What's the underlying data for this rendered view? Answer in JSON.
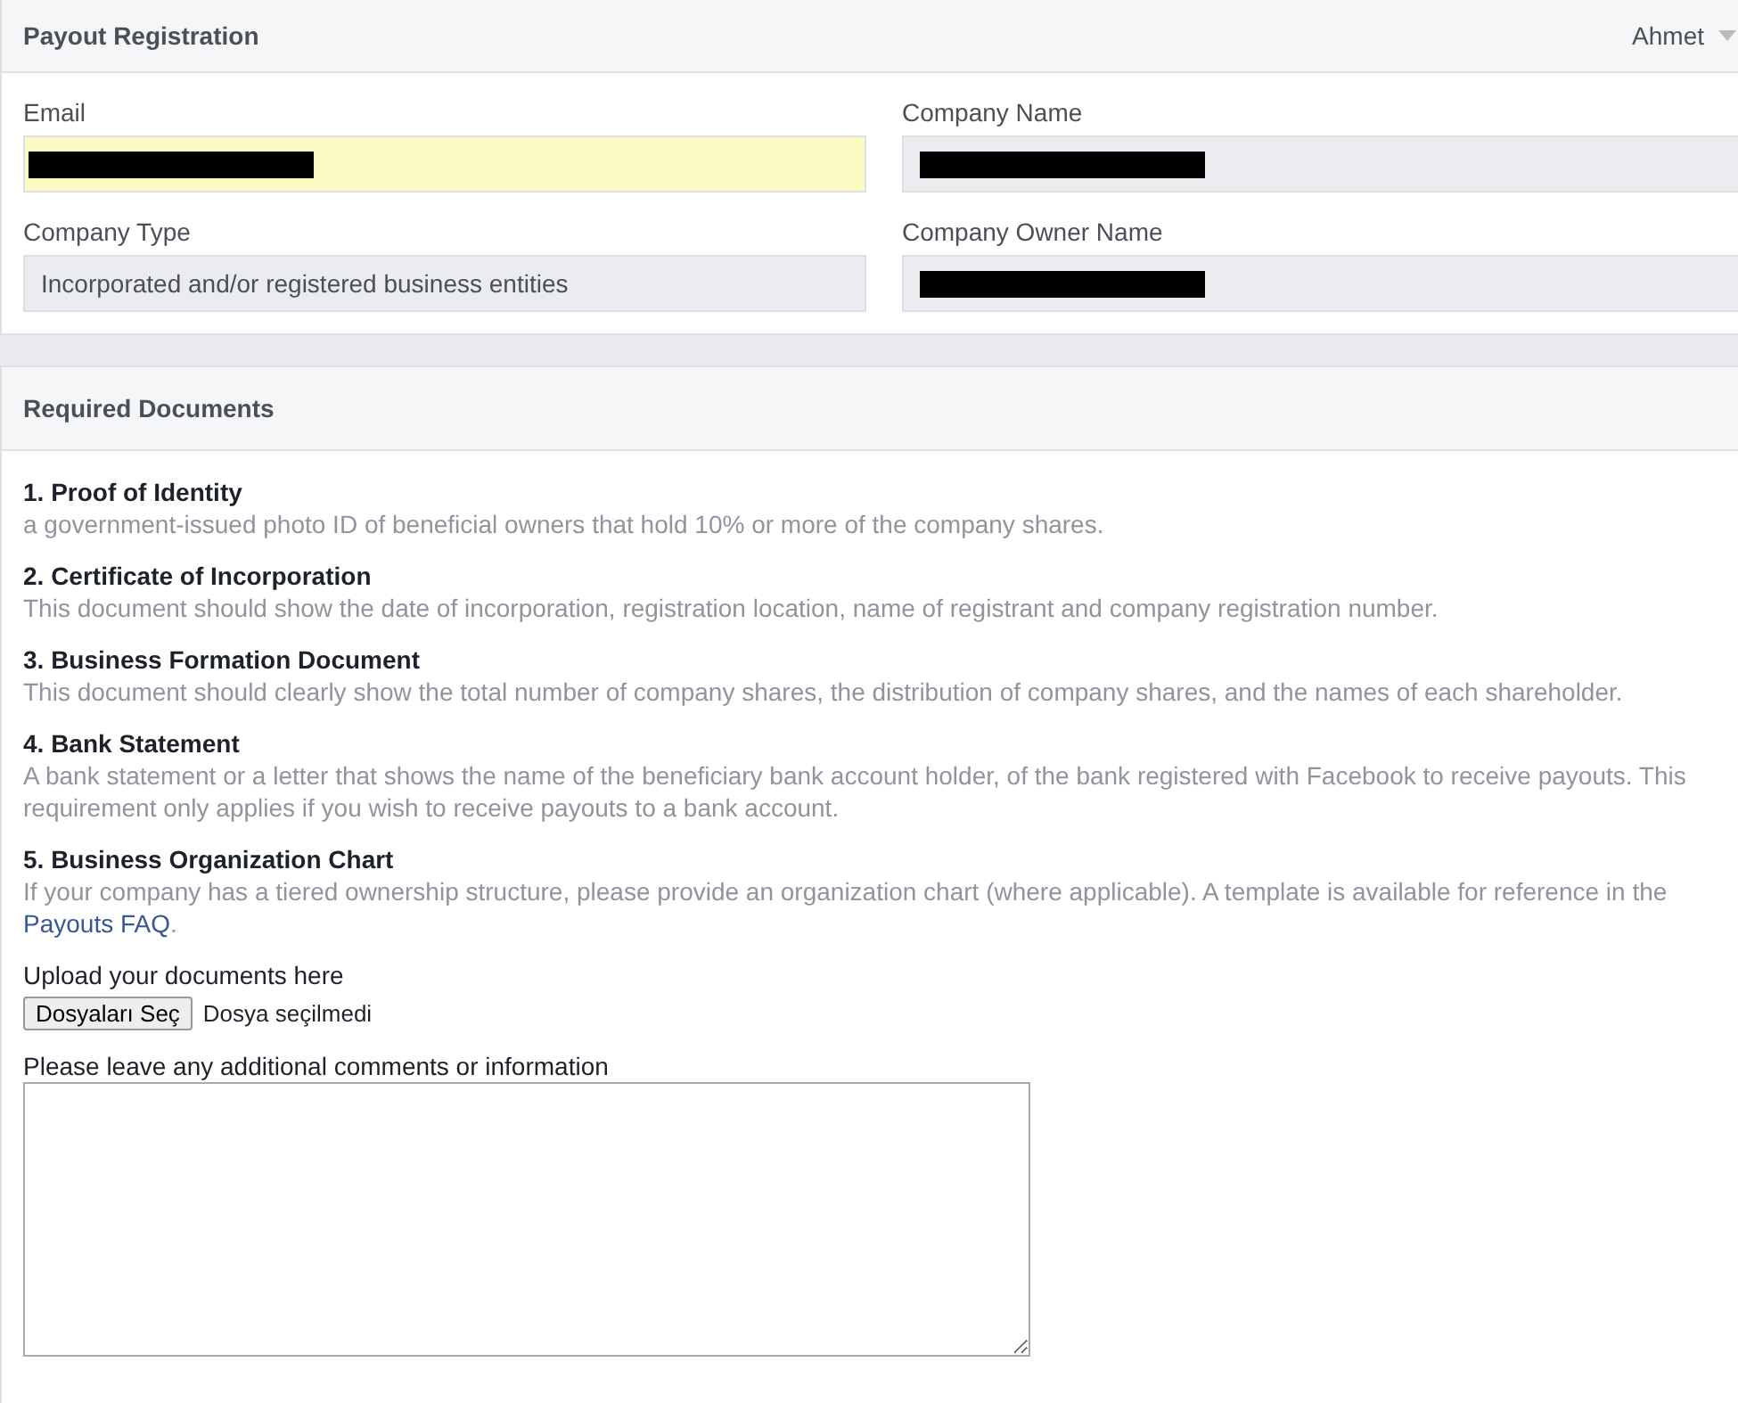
{
  "header": {
    "title": "Payout Registration",
    "user": "Ahmet"
  },
  "fields": [
    {
      "label": "Email",
      "redacted": true,
      "autofilled": true
    },
    {
      "label": "Company Name",
      "redacted": true,
      "autofilled": false
    },
    {
      "label": "Company Type",
      "redacted": false,
      "autofilled": false,
      "value": "Incorporated and/or registered business entities"
    },
    {
      "label": "Company Owner Name",
      "redacted": true,
      "autofilled": false
    }
  ],
  "documents": {
    "title": "Required Documents",
    "items": [
      {
        "title": "1. Proof of Identity",
        "description": "a government-issued photo ID of beneficial owners that hold 10% or more of the company shares."
      },
      {
        "title": "2. Certificate of Incorporation",
        "description": "This document should show the date of incorporation, registration location, name of registrant and company registration number."
      },
      {
        "title": "3. Business Formation Document",
        "description": "This document should clearly show the total number of company shares, the distribution of company shares, and the names of each shareholder."
      },
      {
        "title": "4. Bank Statement",
        "description": "A bank statement or a letter that shows the name of the beneficiary bank account holder, of the bank registered with Facebook to receive payouts. This requirement only applies if you wish to receive payouts to a bank account."
      },
      {
        "title": "5. Business Organization Chart",
        "description": "If your company has a tiered ownership structure, please provide an organization chart (where applicable). A template is available for reference in the",
        "link": "Payouts FAQ",
        "after": "."
      }
    ],
    "upload_label": "Upload your documents here",
    "upload_button": "Dosyaları Seç",
    "upload_status": "Dosya seçilmedi",
    "comments_label": "Please leave any additional comments or information"
  }
}
